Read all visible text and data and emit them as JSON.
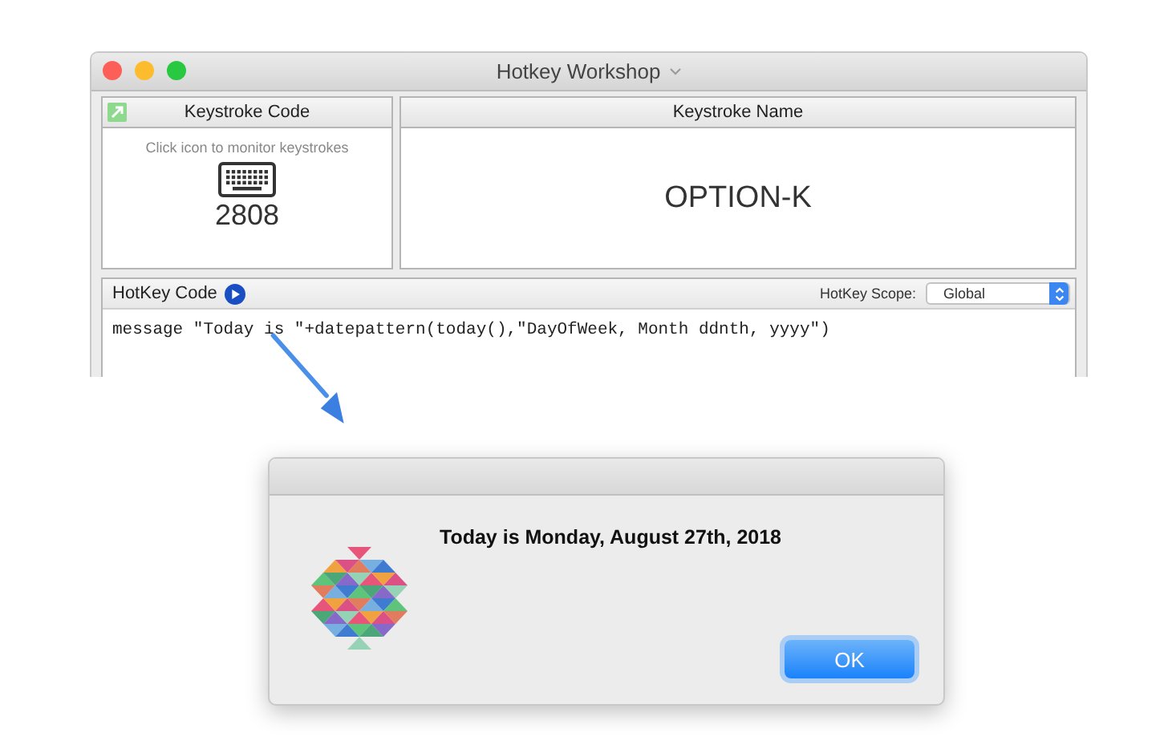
{
  "window": {
    "title": "Hotkey Workshop",
    "keystroke_code": {
      "header": "Keystroke Code",
      "hint": "Click icon to monitor keystrokes",
      "code": "2808"
    },
    "keystroke_name": {
      "header": "Keystroke Name",
      "name": "OPTION-K"
    },
    "hotkey_code": {
      "header": "HotKey Code",
      "scope_label": "HotKey Scope:",
      "scope": "Global",
      "code": "message \"Today is \"+datepattern(today(),\"DayOfWeek, Month ddnth, yyyy\")"
    }
  },
  "dialog": {
    "message": "Today is Monday, August 27th, 2018",
    "buttons": [
      "OK"
    ]
  }
}
